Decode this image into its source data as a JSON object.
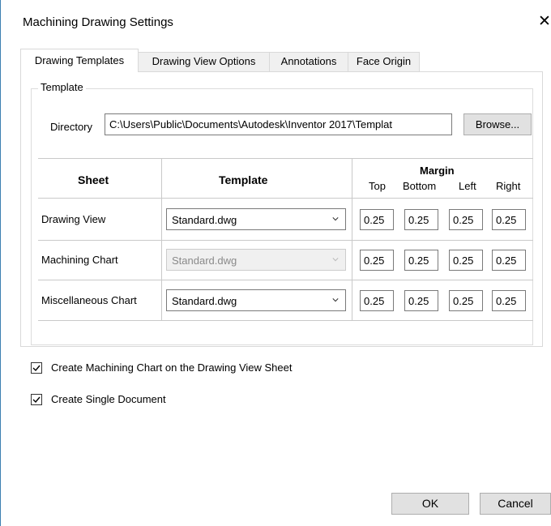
{
  "window": {
    "title": "Machining Drawing Settings",
    "close_glyph": "✕"
  },
  "tabs": [
    {
      "label": "Drawing Templates",
      "active": true
    },
    {
      "label": "Drawing View Options",
      "active": false
    },
    {
      "label": "Annotations",
      "active": false
    },
    {
      "label": "Face Origin",
      "active": false
    }
  ],
  "template_group": {
    "legend": "Template",
    "directory_label": "Directory",
    "directory_value": "C:\\Users\\Public\\Documents\\Autodesk\\Inventor 2017\\Templat",
    "browse_label": "Browse..."
  },
  "table": {
    "headers": {
      "sheet": "Sheet",
      "template": "Template",
      "margin": "Margin"
    },
    "margin_subheaders": [
      "Top",
      "Bottom",
      "Left",
      "Right"
    ],
    "rows": [
      {
        "sheet": "Drawing View",
        "template": "Standard.dwg",
        "template_enabled": true,
        "margins": [
          "0.25",
          "0.25",
          "0.25",
          "0.25"
        ]
      },
      {
        "sheet": "Machining Chart",
        "template": "Standard.dwg",
        "template_enabled": false,
        "margins": [
          "0.25",
          "0.25",
          "0.25",
          "0.25"
        ]
      },
      {
        "sheet": "Miscellaneous Chart",
        "template": "Standard.dwg",
        "template_enabled": true,
        "margins": [
          "0.25",
          "0.25",
          "0.25",
          "0.25"
        ]
      }
    ]
  },
  "options": [
    {
      "label": "Create Machining Chart on the Drawing View Sheet",
      "checked": true
    },
    {
      "label": "Create Single Document",
      "checked": true
    }
  ],
  "footer": {
    "ok_label": "OK",
    "cancel_label": "Cancel"
  },
  "colors": {
    "window_border": "#3c7fb1",
    "disabled_text": "#8a8a8a",
    "button_face": "#e1e1e1"
  },
  "icons": {
    "close": "close-icon",
    "dropdown": "chevron-down-icon",
    "check": "checkmark-icon"
  }
}
